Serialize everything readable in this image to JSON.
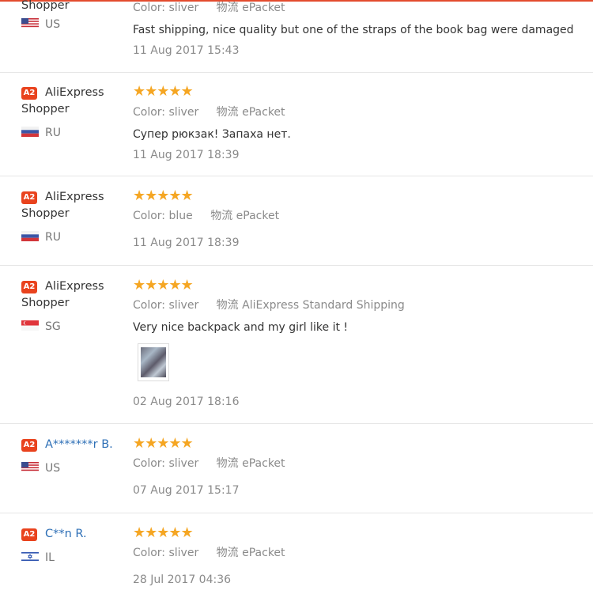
{
  "reviews": [
    {
      "user_line1": "",
      "user_line2": "Shopper",
      "country": "US",
      "color_label": "Color:",
      "color_value": "sliver",
      "shipping_label": "物流",
      "shipping_value": "ePacket",
      "text": "Fast shipping, nice quality but one of the straps of the book bag were damaged",
      "date": "11 Aug 2017 15:43"
    },
    {
      "badge": "A2",
      "user_line1": "AliExpress",
      "user_line2": "Shopper",
      "country": "RU",
      "rating": "★★★★★",
      "color_label": "Color:",
      "color_value": "sliver",
      "shipping_label": "物流",
      "shipping_value": "ePacket",
      "text": "Супер рюкзак! Запаха нет.",
      "date": "11 Aug 2017 18:39"
    },
    {
      "badge": "A2",
      "user_line1": "AliExpress",
      "user_line2": "Shopper",
      "country": "RU",
      "rating": "★★★★★",
      "color_label": "Color:",
      "color_value": "blue",
      "shipping_label": "物流",
      "shipping_value": "ePacket",
      "date": "11 Aug 2017 18:39"
    },
    {
      "badge": "A2",
      "user_line1": "AliExpress",
      "user_line2": "Shopper",
      "country": "SG",
      "rating": "★★★★★",
      "color_label": "Color:",
      "color_value": "sliver",
      "shipping_label": "物流",
      "shipping_value": "AliExpress Standard Shipping",
      "text": "Very nice backpack and my girl like it !",
      "date": "02 Aug 2017 18:16"
    },
    {
      "badge": "A2",
      "user_line1": "A*******r B.",
      "country": "US",
      "rating": "★★★★★",
      "color_label": "Color:",
      "color_value": "sliver",
      "shipping_label": "物流",
      "shipping_value": "ePacket",
      "date": "07 Aug 2017 15:17"
    },
    {
      "badge": "A2",
      "user_line1": "C**n R.",
      "country": "IL",
      "rating": "★★★★★",
      "color_label": "Color:",
      "color_value": "sliver",
      "shipping_label": "物流",
      "shipping_value": "ePacket",
      "date": "28 Jul 2017 04:36"
    }
  ],
  "colors": {
    "accent": "#e34b2e",
    "badge": "#e9431e",
    "star": "#f5a623",
    "link": "#2d6fb6"
  }
}
